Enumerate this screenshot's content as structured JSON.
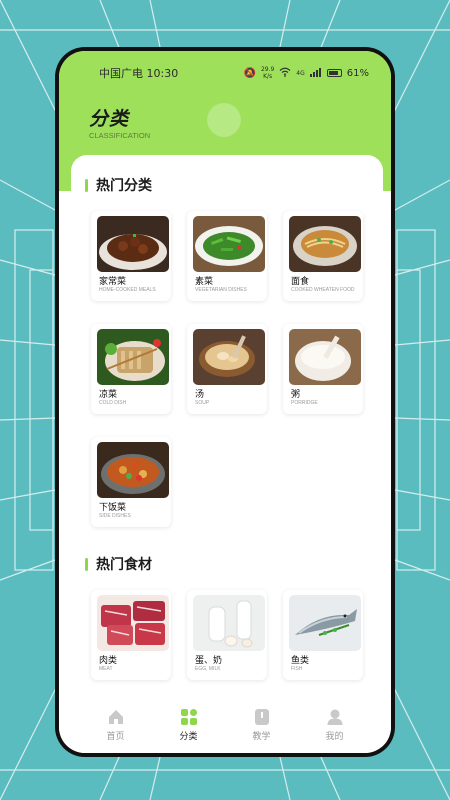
{
  "status_bar": {
    "carrier_time": "中国广电 10:30",
    "speed_value": "29.9",
    "speed_unit": "K/s",
    "network": "4G",
    "battery": "61%"
  },
  "header": {
    "title": "分类",
    "subtitle": "CLASSIFICATION",
    "accent_color": "#9ee05a"
  },
  "sections": [
    {
      "title": "热门分类",
      "items": [
        {
          "name": "家常菜",
          "sub": "HOME-COOKED MEALS",
          "icon": "braised-meat-image"
        },
        {
          "name": "素菜",
          "sub": "VEGETARIAN DISHES",
          "icon": "green-vegetables-image"
        },
        {
          "name": "面食",
          "sub": "COOKED WHEATEN FOOD",
          "icon": "noodle-soup-image"
        },
        {
          "name": "凉菜",
          "sub": "COLD DISH",
          "icon": "cold-dish-image"
        },
        {
          "name": "汤",
          "sub": "SOUP",
          "icon": "soup-image"
        },
        {
          "name": "粥",
          "sub": "PORRIDGE",
          "icon": "porridge-image"
        },
        {
          "name": "下饭菜",
          "sub": "SIDE DISHES",
          "icon": "side-dish-image"
        }
      ]
    },
    {
      "title": "热门食材",
      "items": [
        {
          "name": "肉类",
          "sub": "MEAT",
          "icon": "meat-image"
        },
        {
          "name": "蛋、奶",
          "sub": "EGG, MILK",
          "icon": "egg-milk-image"
        },
        {
          "name": "鱼类",
          "sub": "FISH",
          "icon": "fish-image"
        }
      ]
    }
  ],
  "tabs": [
    {
      "label": "首页",
      "icon": "home-icon",
      "active": false
    },
    {
      "label": "分类",
      "icon": "category-icon",
      "active": true
    },
    {
      "label": "教学",
      "icon": "book-icon",
      "active": false
    },
    {
      "label": "我的",
      "icon": "person-icon",
      "active": false
    }
  ],
  "colors": {
    "background": "#5bbcc0",
    "accent": "#8ed74a",
    "active_icon": "#8ed74a",
    "inactive_icon": "#c9c9c9"
  }
}
